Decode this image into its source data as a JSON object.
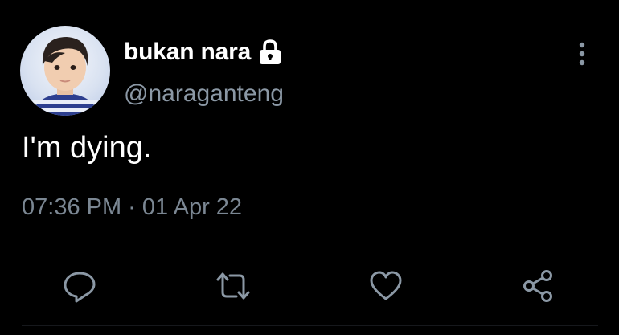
{
  "tweet": {
    "author": {
      "display_name": "bukan nara",
      "handle": "@naraganteng",
      "protected": true,
      "avatar_icon": "avatar-photo",
      "lock_icon": "lock-icon"
    },
    "text": "I'm dying.",
    "timestamp": "07:36 PM · 01 Apr 22",
    "actions": [
      {
        "name": "reply",
        "icon": "reply-icon"
      },
      {
        "name": "retweet",
        "icon": "retweet-icon"
      },
      {
        "name": "like",
        "icon": "heart-icon"
      },
      {
        "name": "share",
        "icon": "share-icon"
      }
    ],
    "menu_icon": "more-vertical-icon"
  },
  "colors": {
    "background": "#000000",
    "primary_text": "#ffffff",
    "secondary_text": "#8b98a5",
    "icon": "#8b98a5",
    "divider": "#2f3336"
  }
}
